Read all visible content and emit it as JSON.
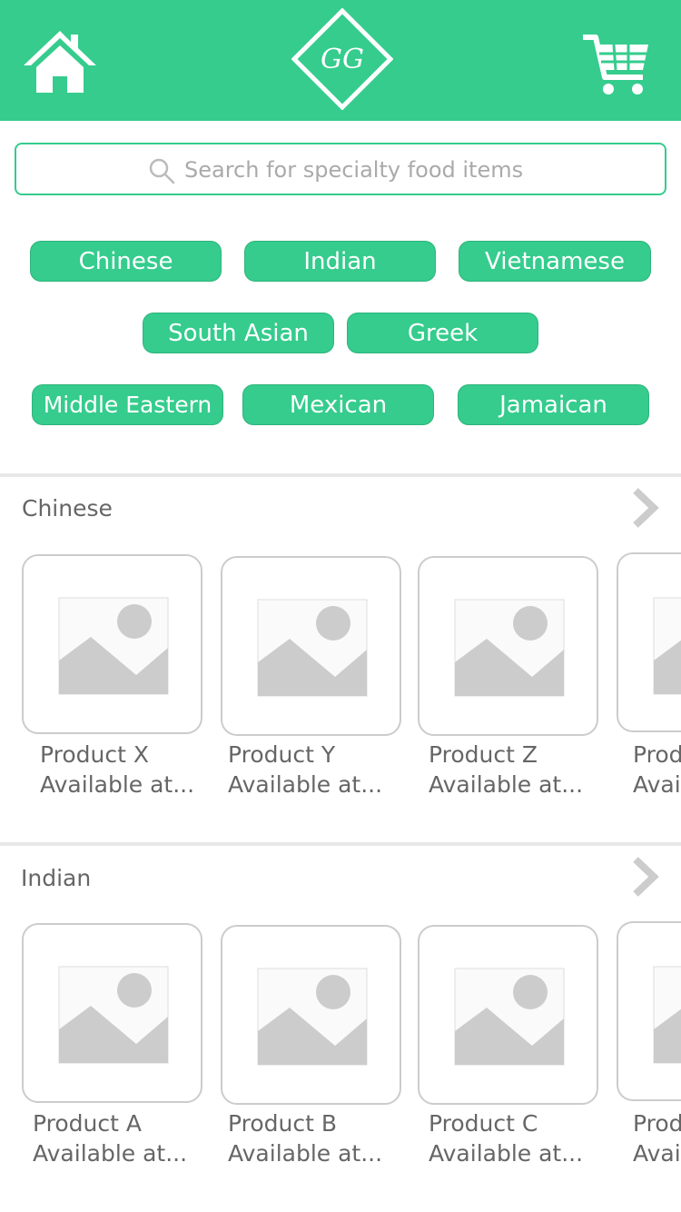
{
  "header": {
    "logo_text": "GG",
    "home_icon": "home-icon",
    "cart_icon": "cart-icon",
    "brand_color": "#35cc8d"
  },
  "search": {
    "placeholder": "Search for specialty food items",
    "value": "",
    "icon": "search-icon"
  },
  "categories": [
    "Chinese",
    "Indian",
    "Vietnamese",
    "South Asian",
    "Greek",
    "Middle Eastern",
    "Mexican",
    "Jamaican"
  ],
  "sections": [
    {
      "title": "Chinese",
      "products": [
        {
          "name": "Product X",
          "sub": "Available at..."
        },
        {
          "name": "Product Y",
          "sub": "Available at..."
        },
        {
          "name": "Product Z",
          "sub": "Available at..."
        },
        {
          "name": "Product",
          "sub": "Available at..."
        }
      ]
    },
    {
      "title": "Indian",
      "products": [
        {
          "name": "Product A",
          "sub": "Available at..."
        },
        {
          "name": "Product B",
          "sub": "Available at..."
        },
        {
          "name": "Product C",
          "sub": "Available at..."
        },
        {
          "name": "Product",
          "sub": "Available at..."
        }
      ]
    }
  ]
}
